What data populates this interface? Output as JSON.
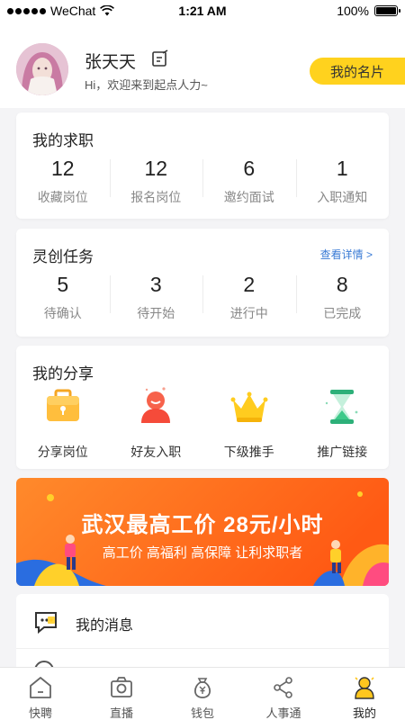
{
  "status_bar": {
    "carrier": "WeChat",
    "time": "1:21 AM",
    "battery": "100%"
  },
  "profile": {
    "name": "张天天",
    "welcome": "Hi，欢迎来到起点人力~",
    "card_button": "我的名片"
  },
  "job_search": {
    "title": "我的求职",
    "stats": [
      {
        "value": "12",
        "label": "收藏岗位"
      },
      {
        "value": "12",
        "label": "报名岗位"
      },
      {
        "value": "6",
        "label": "邀约面试"
      },
      {
        "value": "1",
        "label": "入职通知"
      }
    ]
  },
  "tasks": {
    "title": "灵创任务",
    "more": "查看详情 >",
    "stats": [
      {
        "value": "5",
        "label": "待确认"
      },
      {
        "value": "3",
        "label": "待开始"
      },
      {
        "value": "2",
        "label": "进行中"
      },
      {
        "value": "8",
        "label": "已完成"
      }
    ]
  },
  "share": {
    "title": "我的分享",
    "items": [
      {
        "label": "分享岗位",
        "icon": "briefcase-icon"
      },
      {
        "label": "好友入职",
        "icon": "person-icon"
      },
      {
        "label": "下级推手",
        "icon": "crown-icon"
      },
      {
        "label": "推广链接",
        "icon": "hourglass-icon"
      }
    ]
  },
  "banner": {
    "title": "武汉最高工价 28元/小时",
    "subtitle": "高工价 高福利 高保障 让利求职者"
  },
  "messages": {
    "label": "我的消息"
  },
  "tabs": [
    {
      "label": "快聘",
      "icon": "house-icon"
    },
    {
      "label": "直播",
      "icon": "camera-icon"
    },
    {
      "label": "钱包",
      "icon": "money-bag-icon"
    },
    {
      "label": "人事通",
      "icon": "share-nodes-icon"
    },
    {
      "label": "我的",
      "icon": "user-icon"
    }
  ],
  "colors": {
    "accent": "#ffd21e",
    "link": "#3a7bd5",
    "banner": "#ff6a1a"
  }
}
